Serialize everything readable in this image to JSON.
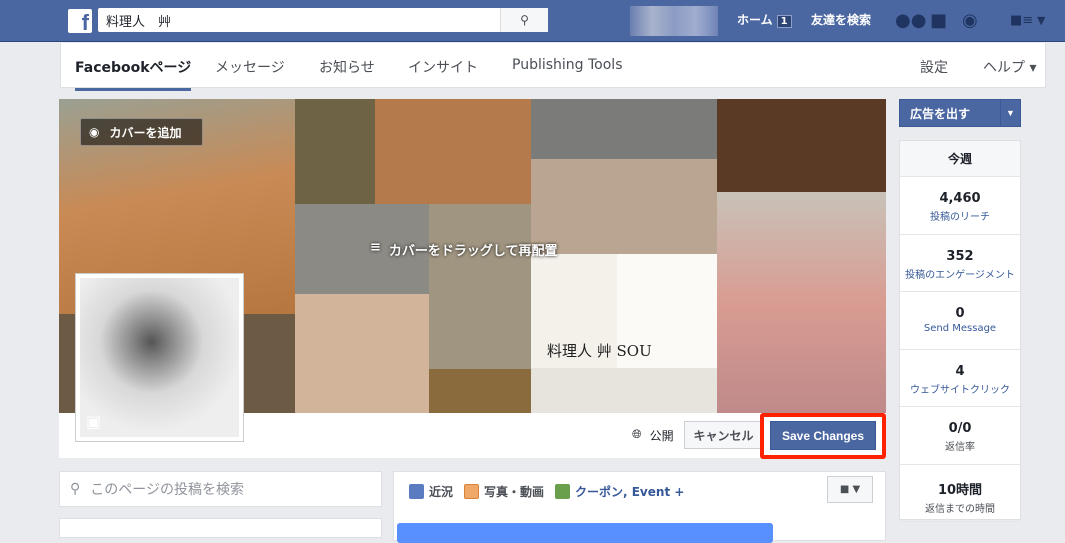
{
  "topbar": {
    "logo": "f",
    "search_value": "料理人　艸",
    "home": "ホーム",
    "home_badge": "1",
    "find_friends": "友達を検索"
  },
  "nav": {
    "tabs": [
      "Facebookページ",
      "メッセージ",
      "お知らせ",
      "インサイト",
      "Publishing Tools"
    ],
    "settings": "設定",
    "help": "ヘルプ ▾"
  },
  "cover": {
    "add_cover": "カバーを追加",
    "drag_hint": "カバーをドラッグして再配置",
    "logo_text": "料理人 艸 SOU",
    "privacy": "公開",
    "cancel": "キャンセル",
    "save": "Save Changes",
    "highlight_color": "#ff2200"
  },
  "left": {
    "search_placeholder": "このページの投稿を検索"
  },
  "composer": {
    "tabs": [
      "近況",
      "写真・動画",
      "クーポン, Event +"
    ]
  },
  "right": {
    "ads_button": "広告を出す",
    "week": "今週",
    "stats": [
      {
        "value": "4,460",
        "label": "投稿のリーチ"
      },
      {
        "value": "352",
        "label": "投稿のエンゲージメント"
      },
      {
        "value": "0",
        "label": "Send Message"
      },
      {
        "value": "4",
        "label": "ウェブサイトクリック"
      },
      {
        "value": "0/0",
        "label": "返信率"
      },
      {
        "value": "10時間",
        "label": "返信までの時間"
      }
    ]
  },
  "colors": {
    "brand": "#4b67a1",
    "link": "#365899"
  }
}
